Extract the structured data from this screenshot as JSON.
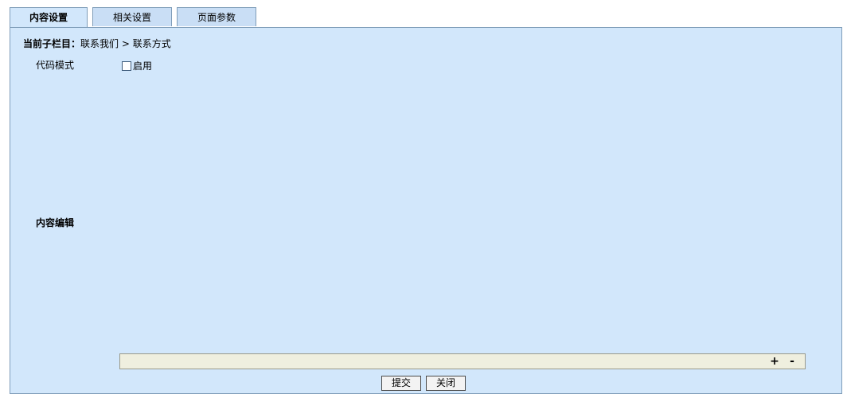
{
  "tabs": [
    {
      "label": "内容设置",
      "active": true
    },
    {
      "label": "相关设置",
      "active": false
    },
    {
      "label": "页面参数",
      "active": false
    }
  ],
  "breadcrumb": {
    "label": "当前子栏目：",
    "path": "联系我们 > 联系方式"
  },
  "code_mode": {
    "label": "代码模式",
    "checkbox_label": "启用",
    "checked": false
  },
  "content_edit": {
    "label": "内容编辑"
  },
  "resize": {
    "plus": "+",
    "minus": "-"
  },
  "actions": {
    "submit": "提交",
    "close": "关闭"
  },
  "colors": {
    "panel_bg": "#d2e7fb",
    "tab_bg": "#c9def5",
    "border": "#7f9db9",
    "resize_bar_bg": "#efefdf"
  }
}
